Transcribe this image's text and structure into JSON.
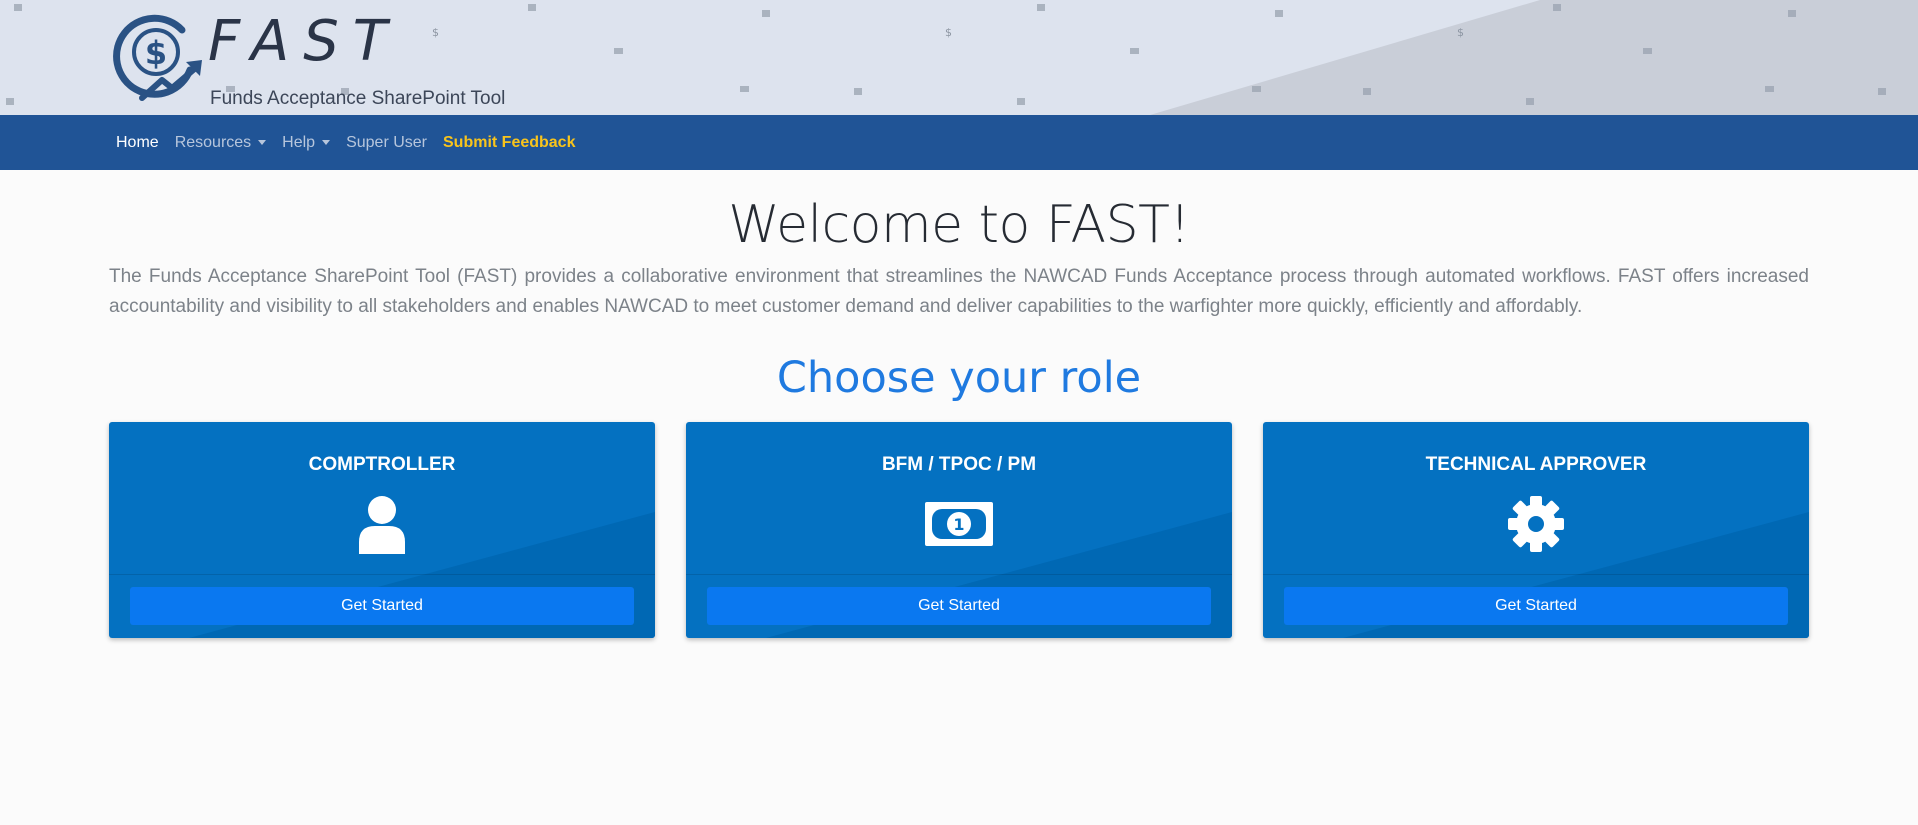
{
  "header": {
    "logo_title": "FAST",
    "logo_subtitle": "Funds Acceptance SharePoint Tool"
  },
  "nav": {
    "items": [
      {
        "label": "Home",
        "active": true,
        "dropdown": false
      },
      {
        "label": "Resources",
        "dropdown": true
      },
      {
        "label": "Help",
        "dropdown": true
      },
      {
        "label": "Super User",
        "dropdown": false
      },
      {
        "label": "Submit Feedback",
        "highlight": true
      }
    ]
  },
  "main": {
    "title": "Welcome to FAST!",
    "intro": "The Funds Acceptance SharePoint Tool (FAST) provides a collaborative environment that streamlines the NAWCAD Funds Acceptance process through automated workflows. FAST offers increased accountability and visibility to all stakeholders and enables NAWCAD to meet customer demand and deliver capabilities to the warfighter more quickly, efficiently and affordably.",
    "choose_heading": "Choose your role"
  },
  "roles": [
    {
      "title": "COMPTROLLER",
      "icon": "user-icon",
      "button": "Get Started"
    },
    {
      "title": "BFM / TPOC / PM",
      "icon": "money-bill-icon",
      "button": "Get Started"
    },
    {
      "title": "TECHNICAL APPROVER",
      "icon": "gear-icon",
      "button": "Get Started"
    }
  ],
  "colors": {
    "nav_bg": "#205496",
    "feedback": "#f8c41c",
    "card_bg": "#0471c1",
    "button_bg": "#0a78f0",
    "heading_blue": "#1f7ae0"
  }
}
